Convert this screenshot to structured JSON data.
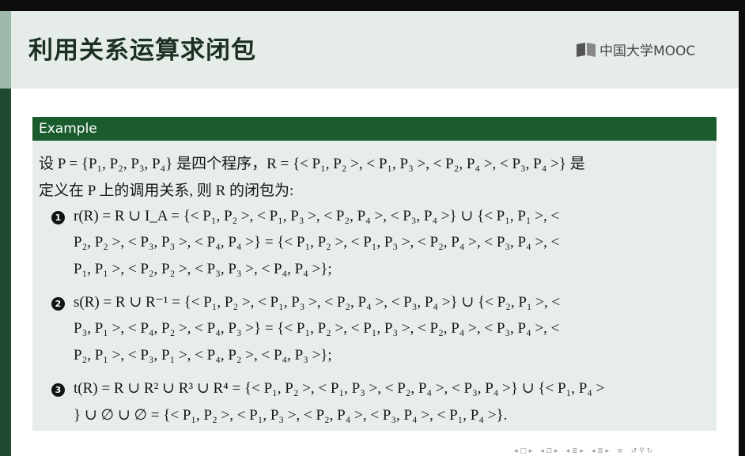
{
  "header": {
    "title": "利用关系运算求闭包",
    "logo_text": "中国大学MOOC"
  },
  "block": {
    "title": "Example",
    "intro_line1": "设 P = {P₁, P₂, P₃, P₄} 是四个程序，R = {< P₁, P₂ >, < P₁, P₃ >, < P₂, P₄ >, < P₃, P₄ >} 是",
    "intro_line2": "定义在 P 上的调用关系, 则 R 的闭包为:",
    "items": [
      {
        "marker": "1",
        "lines": [
          "r(R) = R ∪ I_A = {< P₁, P₂ >, < P₁, P₃ >, < P₂, P₄ >, < P₃, P₄ >} ∪ {< P₁, P₁ >, <",
          "P₂, P₂ >, < P₃, P₃ >, < P₄, P₄ >} = {< P₁, P₂ >, < P₁, P₃ >, < P₂, P₄ >, < P₃, P₄ >, <",
          "P₁, P₁ >, < P₂, P₂ >, < P₃, P₃ >, < P₄, P₄ >};"
        ]
      },
      {
        "marker": "2",
        "lines": [
          "s(R) = R ∪ R⁻¹ = {< P₁, P₂ >, < P₁, P₃ >, < P₂, P₄ >, < P₃, P₄ >} ∪ {< P₂, P₁ >, <",
          "P₃, P₁ >, < P₄, P₂ >, < P₄, P₃ >} = {< P₁, P₂ >, < P₁, P₃ >, < P₂, P₄ >, < P₃, P₄ >, <",
          "P₂, P₁ >, < P₃, P₁ >, < P₄, P₂ >, < P₄, P₃ >};"
        ]
      },
      {
        "marker": "3",
        "lines": [
          "t(R) = R ∪ R² ∪ R³ ∪ R⁴ = {< P₁, P₂ >, < P₁, P₃ >, < P₂, P₄ >, < P₃, P₄ >} ∪ {< P₁, P₄ >",
          "} ∪ ∅ ∪ ∅ = {< P₁, P₂ >, < P₁, P₃ >, < P₂, P₄ >, < P₃, P₄ >, < P₁, P₄ >}."
        ]
      }
    ]
  },
  "nav": {
    "symbols": [
      "◂ □ ▸",
      "◂ ⊡ ▸",
      "◂ ≣ ▸",
      "◂ ≣ ▸",
      "≡",
      "↺ ⚲ ↻"
    ]
  },
  "colors": {
    "header_bg": "#e6ede9",
    "block_title_bg": "#1b5c2e",
    "block_body_bg": "#e7eee9",
    "left_stripe": "#1e4a32"
  }
}
